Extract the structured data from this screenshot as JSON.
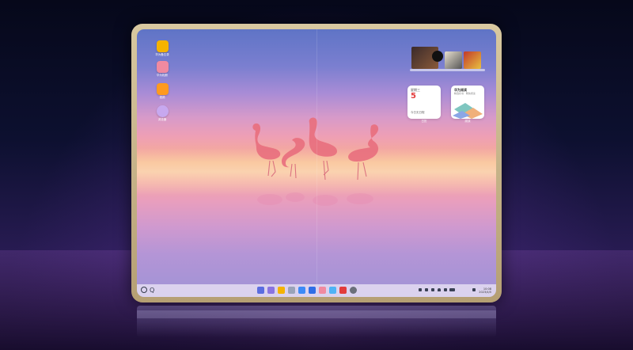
{
  "desktop_icons": [
    {
      "label": "华为备忘录",
      "color": "#f5b300",
      "icon": "memo-icon"
    },
    {
      "label": "华为相册",
      "color": "#f08aa0",
      "icon": "gallery-icon"
    },
    {
      "label": "视频",
      "color": "#ff9a1f",
      "icon": "video-icon"
    },
    {
      "label": "浏览器",
      "color": "#c7a8ef",
      "icon": "browser-icon"
    }
  ],
  "widgets": {
    "calendar": {
      "weekday": "星期三",
      "day": "5",
      "note": "今日无日程",
      "caption": "日历"
    },
    "reading": {
      "title": "华为阅读",
      "subtitle": "精选好书 · 畅快阅读",
      "caption": "阅读"
    }
  },
  "taskbar": {
    "search_glyph": "Q",
    "apps": [
      {
        "name": "menu-icon",
        "color": "#5b6de0"
      },
      {
        "name": "messages-icon",
        "color": "#8a74e0"
      },
      {
        "name": "notes-icon",
        "color": "#f5b300"
      },
      {
        "name": "files-icon",
        "color": "#9aa3b8"
      },
      {
        "name": "browser-icon",
        "color": "#3d8af7"
      },
      {
        "name": "mail-icon",
        "color": "#2f6ee6"
      },
      {
        "name": "gallery-icon",
        "color": "#f08aa0"
      },
      {
        "name": "weather-icon",
        "color": "#4fb3f5"
      },
      {
        "name": "store-icon",
        "color": "#e23c3c"
      },
      {
        "name": "settings-icon",
        "color": "#6b6f7a"
      }
    ],
    "tray": [
      "chevron-up-icon",
      "keyboard-icon",
      "ime-icon",
      "wifi-icon",
      "volume-icon",
      "battery-icon",
      "notification-icon"
    ],
    "time": "10:08",
    "date": "2023/4/5"
  }
}
